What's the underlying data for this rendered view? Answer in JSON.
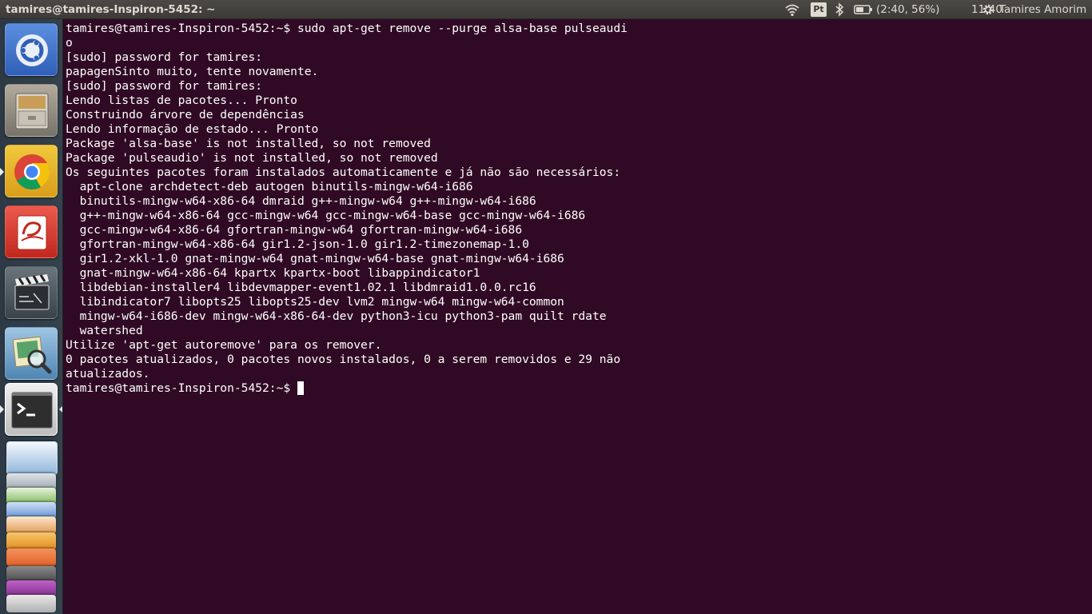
{
  "top_panel": {
    "window_title": "tamires@tamires-Inspiron-5452: ~",
    "keyboard_layout": "Pt",
    "battery_text": "(2:40, 56%)",
    "clock": "11:40",
    "user_name": "Tamires Amorim",
    "icons": [
      "wifi-icon",
      "keyboard-layout-indicator",
      "bluetooth-icon",
      "battery-icon",
      "gear-icon"
    ]
  },
  "launcher": {
    "items": [
      {
        "name": "ubuntu-dash-icon",
        "color": "#3b6fc4"
      },
      {
        "name": "files-icon",
        "color": "#8b8678"
      },
      {
        "name": "chrome-icon",
        "color": "#e8b530"
      },
      {
        "name": "evince-icon",
        "color": "#d43a2f"
      },
      {
        "name": "video-editor-icon",
        "color": "#4a5560"
      },
      {
        "name": "image-viewer-icon",
        "color": "#7cb1d6"
      },
      {
        "name": "terminal-icon",
        "color": "#dddddd"
      }
    ],
    "stacked_items": [
      "writer-icon",
      "disk-icon",
      "calc-icon",
      "chrome-icon-stacked",
      "impress-icon",
      "amazon-icon",
      "software-center-icon",
      "settings-icon",
      "trash-icon"
    ]
  },
  "terminal": {
    "lines": [
      "tamires@tamires-Inspiron-5452:~$ sudo apt-get remove --purge alsa-base pulseaudi",
      "o",
      "[sudo] password for tamires: ",
      "papagenSinto muito, tente novamente.",
      "[sudo] password for tamires: ",
      "Lendo listas de pacotes... Pronto",
      "Construindo árvore de dependências",
      "Lendo informação de estado... Pronto",
      "Package 'alsa-base' is not installed, so not removed",
      "Package 'pulseaudio' is not installed, so not removed",
      "Os seguintes pacotes foram instalados automaticamente e já não são necessários:",
      "  apt-clone archdetect-deb autogen binutils-mingw-w64-i686",
      "  binutils-mingw-w64-x86-64 dmraid g++-mingw-w64 g++-mingw-w64-i686",
      "  g++-mingw-w64-x86-64 gcc-mingw-w64 gcc-mingw-w64-base gcc-mingw-w64-i686",
      "  gcc-mingw-w64-x86-64 gfortran-mingw-w64 gfortran-mingw-w64-i686",
      "  gfortran-mingw-w64-x86-64 gir1.2-json-1.0 gir1.2-timezonemap-1.0",
      "  gir1.2-xkl-1.0 gnat-mingw-w64 gnat-mingw-w64-base gnat-mingw-w64-i686",
      "  gnat-mingw-w64-x86-64 kpartx kpartx-boot libappindicator1",
      "  libdebian-installer4 libdevmapper-event1.02.1 libdmraid1.0.0.rc16",
      "  libindicator7 libopts25 libopts25-dev lvm2 mingw-w64 mingw-w64-common",
      "  mingw-w64-i686-dev mingw-w64-x86-64-dev python3-icu python3-pam quilt rdate",
      "  watershed",
      "Utilize 'apt-get autoremove' para os remover.",
      "0 pacotes atualizados, 0 pacotes novos instalados, 0 a serem removidos e 29 não",
      "atualizados."
    ],
    "prompt": "tamires@tamires-Inspiron-5452:~$ ",
    "background": "#300a24",
    "foreground": "#ffffff"
  }
}
